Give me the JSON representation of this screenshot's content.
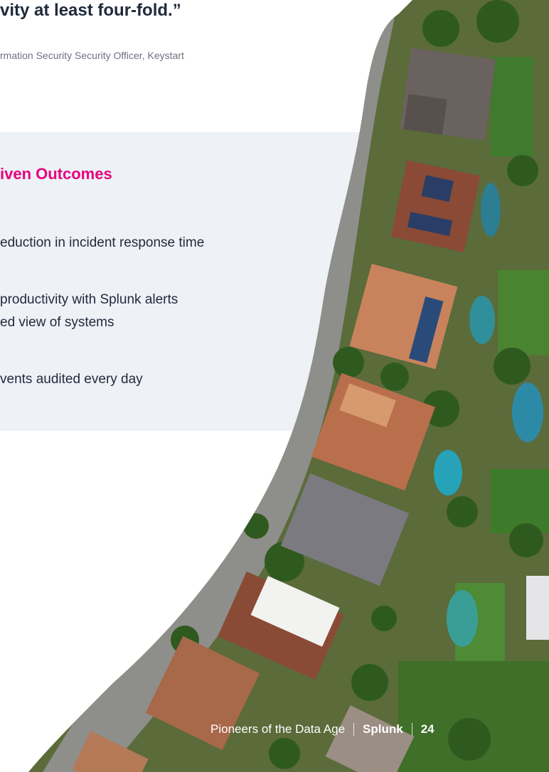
{
  "quote": {
    "tail": "vity at least four-fold.”",
    "attribution": "rmation Security Security Officer, Keystart"
  },
  "outcomes": {
    "heading": "iven Outcomes",
    "lines": [
      "eduction in incident response time",
      " productivity with Splunk alerts",
      "ed view of systems",
      "vents audited every day"
    ]
  },
  "footer": {
    "publication": "Pioneers of the Data Age",
    "brand": "Splunk",
    "page_number": "24"
  },
  "colors": {
    "accent": "#e5007e",
    "panel": "#eef1f6",
    "text": "#1f2a3c"
  }
}
